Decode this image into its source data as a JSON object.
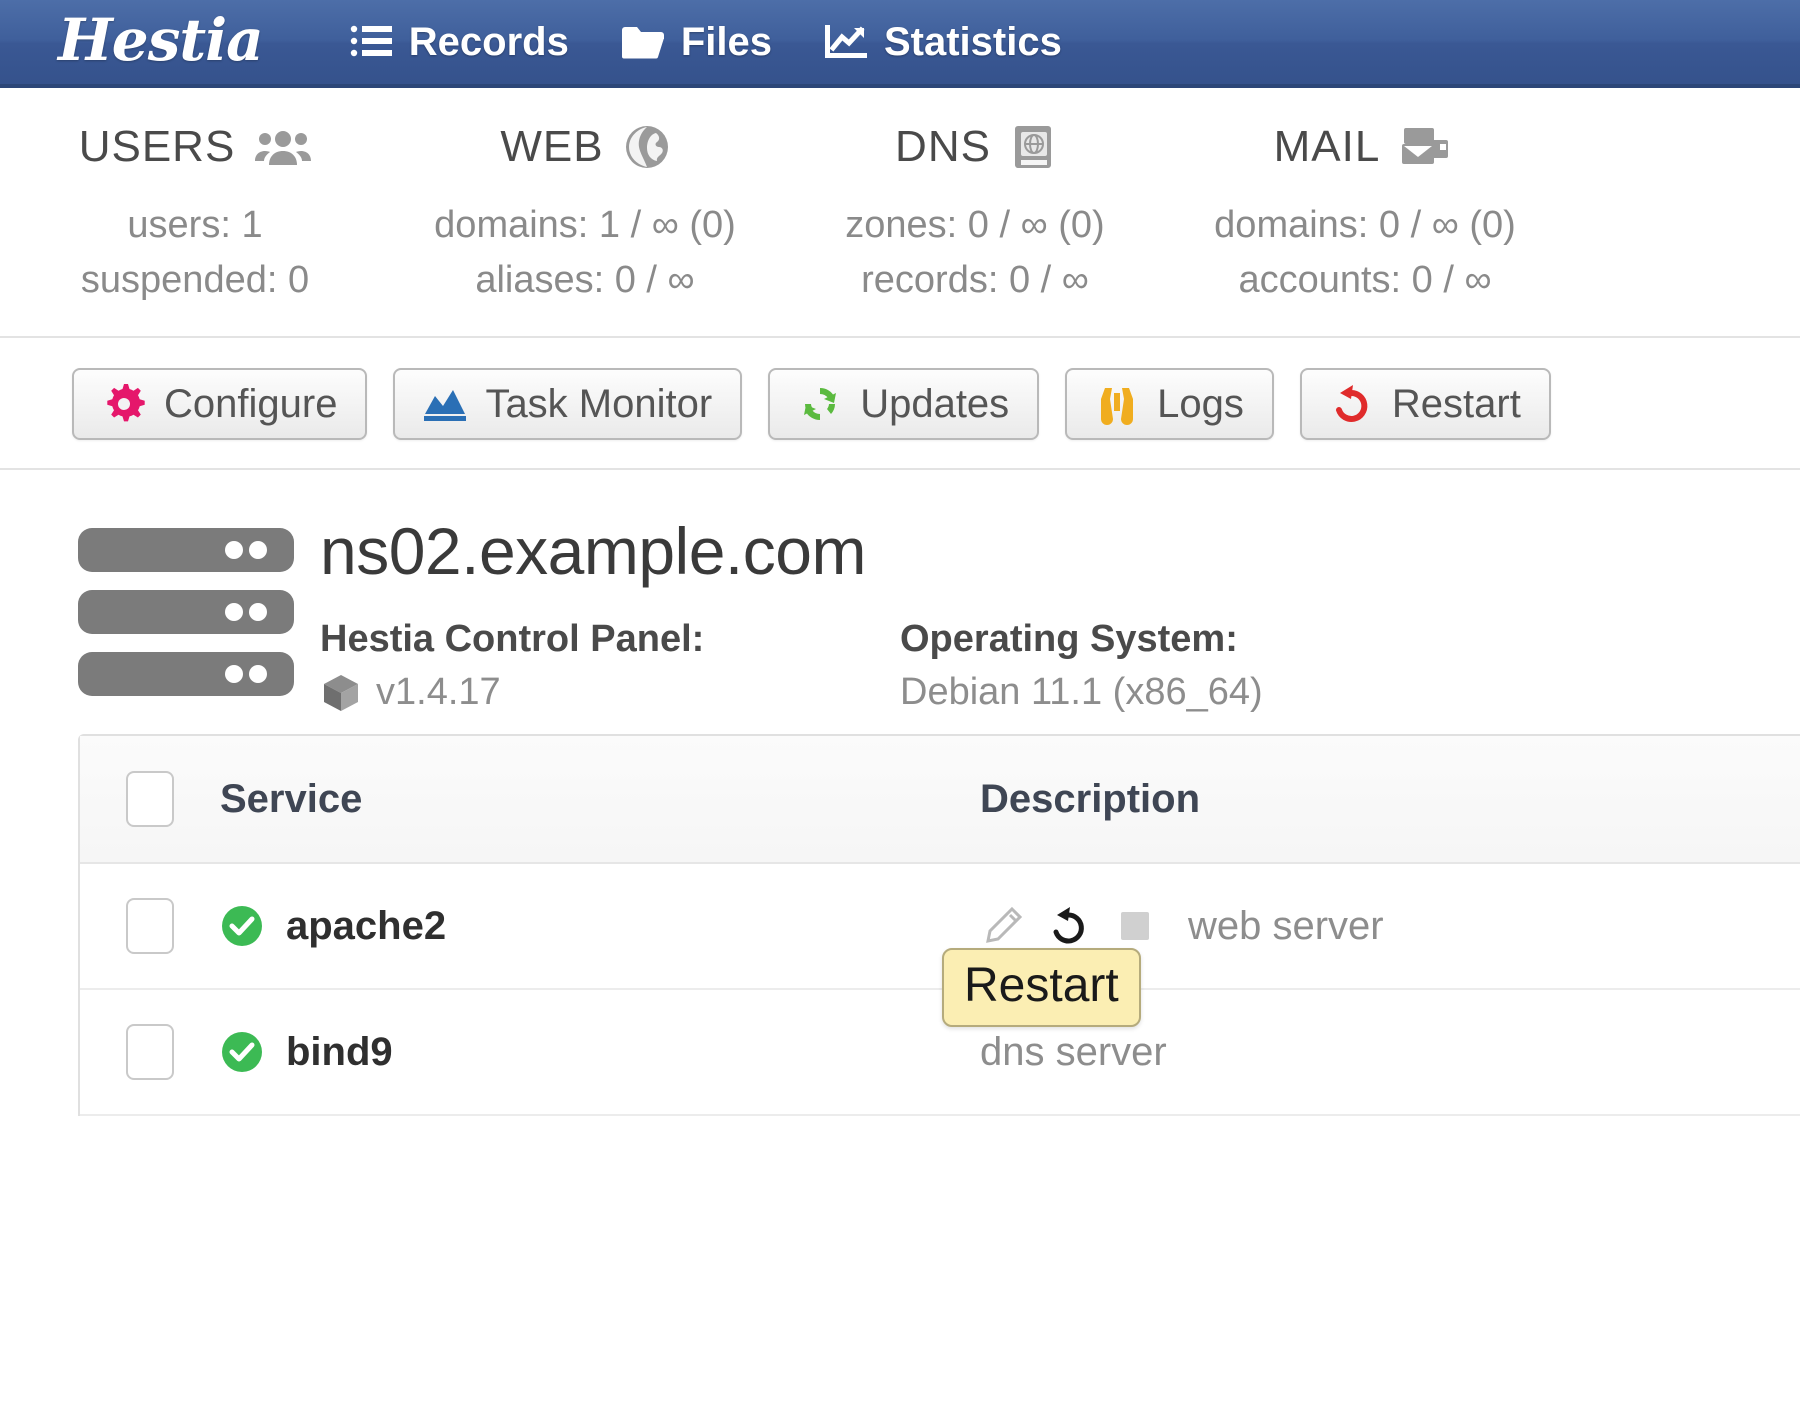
{
  "navbar": {
    "brand": "Hestia",
    "items": [
      {
        "label": "Records",
        "icon": "list-icon"
      },
      {
        "label": "Files",
        "icon": "folder-icon"
      },
      {
        "label": "Statistics",
        "icon": "chart-line-icon"
      }
    ]
  },
  "stats": [
    {
      "title": "USERS",
      "icon": "users-icon",
      "lines": [
        "users: 1",
        "suspended: 0"
      ]
    },
    {
      "title": "WEB",
      "icon": "globe-icon",
      "lines": [
        "domains: 1 / ∞ (0)",
        "aliases: 0 / ∞"
      ]
    },
    {
      "title": "DNS",
      "icon": "dns-book-icon",
      "lines": [
        "zones: 0 / ∞ (0)",
        "records: 0 / ∞"
      ]
    },
    {
      "title": "MAIL",
      "icon": "mail-icon",
      "lines": [
        "domains: 0 / ∞ (0)",
        "accounts: 0 / ∞"
      ]
    }
  ],
  "toolbar": [
    {
      "label": "Configure",
      "icon": "gear-icon",
      "color": "#e5176b"
    },
    {
      "label": "Task Monitor",
      "icon": "chart-area-icon",
      "color": "#2a6fb5"
    },
    {
      "label": "Updates",
      "icon": "refresh-icon",
      "color": "#5bba3f"
    },
    {
      "label": "Logs",
      "icon": "binoculars-icon",
      "color": "#f0ad1f"
    },
    {
      "label": "Restart",
      "icon": "undo-icon",
      "color": "#e02b2b"
    }
  ],
  "server": {
    "hostname": "ns02.example.com",
    "panel_label": "Hestia Control Panel:",
    "panel_version": "v1.4.17",
    "panel_icon": "cube-icon",
    "os_label": "Operating System:",
    "os_value": "Debian 11.1 (x86_64)",
    "server_icon": "server-rack-icon"
  },
  "services": {
    "columns": [
      "Service",
      "Description"
    ],
    "rows": [
      {
        "name": "apache2",
        "description": "web server",
        "status": "running",
        "actions": [
          "edit-icon",
          "restart-icon",
          "stop-icon"
        ]
      },
      {
        "name": "bind9",
        "description": "dns server",
        "status": "running",
        "actions": []
      }
    ]
  },
  "tooltip": {
    "text": "Restart"
  },
  "colors": {
    "navbar": "#3f5f9b",
    "status_ok": "#3cba54",
    "tooltip_bg": "#fbeeb3"
  }
}
